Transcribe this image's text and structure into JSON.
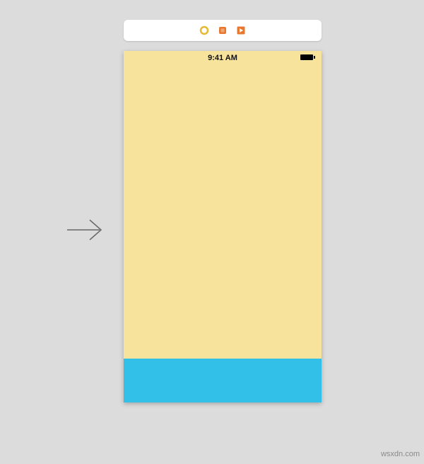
{
  "status_bar": {
    "time": "9:41 AM"
  },
  "toolbar": {
    "icons": {
      "breakpoint": "breakpoint-icon",
      "scene_dock": "scene-dock-icon",
      "preview": "preview-icon"
    }
  },
  "colors": {
    "canvas_bg": "#dcdcdc",
    "toolbar_bg": "#ffffff",
    "top_view": "#f7e39b",
    "bottom_view": "#32bfe8",
    "icon_accent": "#e8782f",
    "icon_yellow": "#e8b82f"
  },
  "watermark": "wsxdn.com"
}
